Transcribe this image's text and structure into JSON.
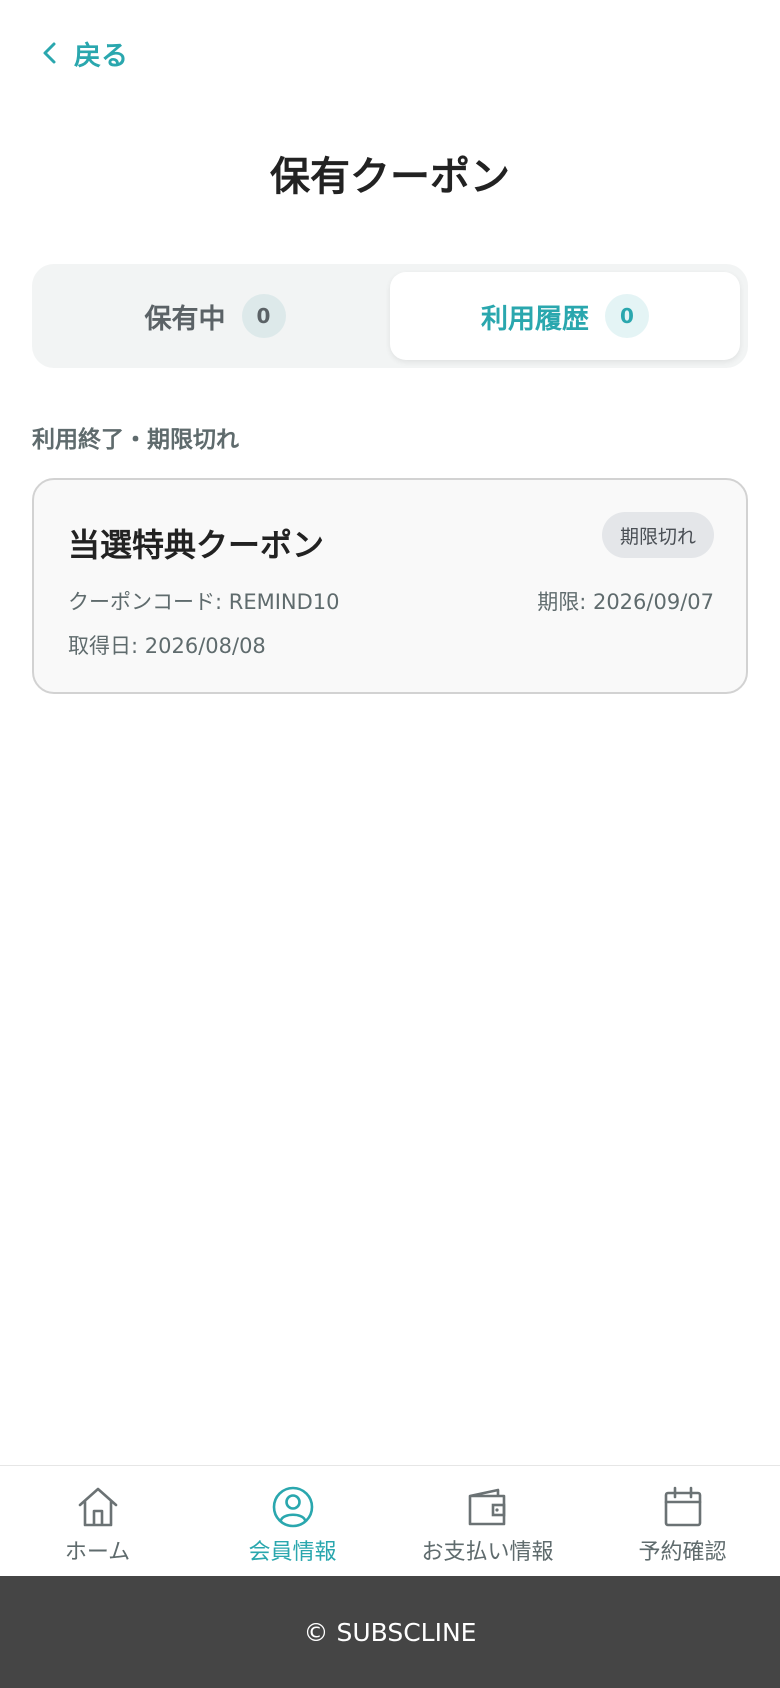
{
  "header": {
    "back_label": "戻る",
    "title": "保有クーポン"
  },
  "tabs": [
    {
      "label": "保有中",
      "count": "0"
    },
    {
      "label": "利用履歴",
      "count": "0"
    }
  ],
  "section": {
    "label": "利用終了・期限切れ"
  },
  "coupon": {
    "title": "当選特典クーポン",
    "status": "期限切れ",
    "code": "クーポンコード: REMIND10",
    "expiry": "期限: 2026/09/07",
    "acquired": "取得日: 2026/08/08"
  },
  "bottom_nav": [
    {
      "label": "ホーム",
      "icon": "home-icon"
    },
    {
      "label": "会員情報",
      "icon": "user-icon"
    },
    {
      "label": "お支払い情報",
      "icon": "wallet-icon"
    },
    {
      "label": "予約確認",
      "icon": "calendar-icon"
    }
  ],
  "footer": {
    "text": "© SUBSCLINE"
  },
  "colors": {
    "accent": "#2aa7ae",
    "muted_text": "#5f6b6d",
    "footer_bg": "#454545"
  }
}
